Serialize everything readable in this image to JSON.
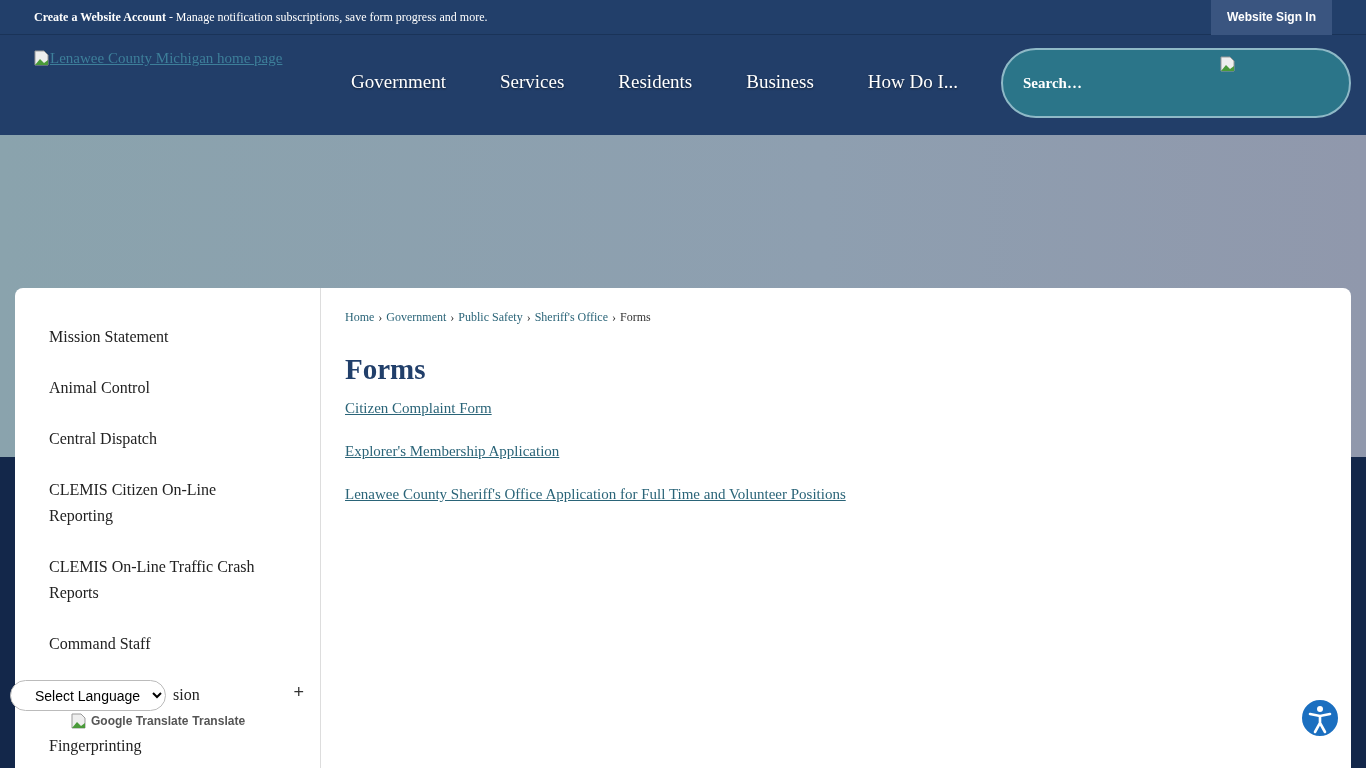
{
  "top_bar": {
    "account_link": "Create a Website Account",
    "account_note": " - Manage notification subscriptions, save form progress and more.",
    "sign_in": "Website Sign In"
  },
  "header": {
    "logo_alt": "Lenawee County Michigan home page",
    "nav": [
      "Government",
      "Services",
      "Residents",
      "Business",
      "How Do I..."
    ],
    "search": {
      "placeholder": "Search…"
    }
  },
  "sidebar": {
    "items": [
      {
        "label": "Mission Statement",
        "kind": "link"
      },
      {
        "label": "Animal Control",
        "kind": "link"
      },
      {
        "label": "Central Dispatch",
        "kind": "link"
      },
      {
        "label": "CLEMIS Citizen On-Line Reporting",
        "kind": "link"
      },
      {
        "label": "CLEMIS On-Line Traffic Crash Reports",
        "kind": "link"
      },
      {
        "label": "Command Staff",
        "kind": "link"
      },
      {
        "label": "sion",
        "kind": "covered_expandable",
        "toggle": "+"
      },
      {
        "label": "Fingerprinting",
        "kind": "link"
      }
    ]
  },
  "breadcrumb": [
    {
      "label": "Home",
      "link": true
    },
    {
      "label": "Government",
      "link": true
    },
    {
      "label": "Public Safety",
      "link": true
    },
    {
      "label": "Sheriff's Office",
      "link": true
    },
    {
      "label": "Forms",
      "link": false
    }
  ],
  "breadcrumb_separator": "›",
  "page_title": "Forms",
  "links": [
    "Citizen Complaint Form",
    "Explorer's Membership Application",
    "Lenawee County Sheriff's Office Application for Full Time and Volunteer Positions"
  ],
  "translate": {
    "select": "Select Language",
    "image_alt": "Google Translate",
    "label": "Translate"
  }
}
